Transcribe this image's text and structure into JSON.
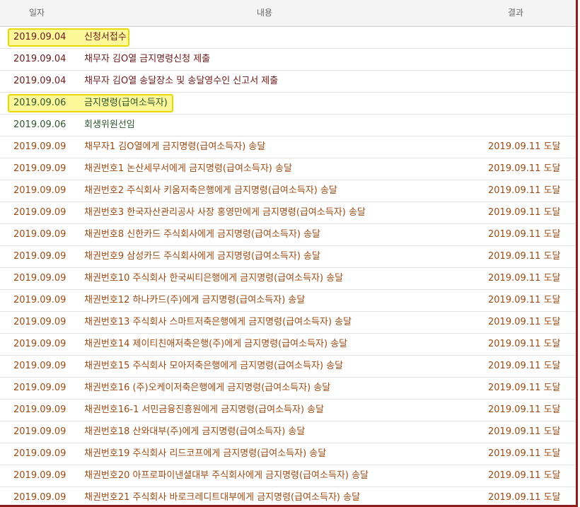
{
  "table": {
    "headers": {
      "date": "일자",
      "content": "내용",
      "result": "결과"
    },
    "rows": [
      {
        "date": "2019.09.04",
        "content": "신청서접수",
        "result": "",
        "kind": "filing",
        "highlight": true
      },
      {
        "date": "2019.09.04",
        "content": "채무자 김O열 금지명령신청 제출",
        "result": "",
        "kind": "filing",
        "highlight": false
      },
      {
        "date": "2019.09.04",
        "content": "채무자 김O열 송달장소 및 송달영수인 신고서 제출",
        "result": "",
        "kind": "filing",
        "highlight": false
      },
      {
        "date": "2019.09.06",
        "content": "금지명령(급여소득자)",
        "result": "",
        "kind": "court",
        "highlight": true
      },
      {
        "date": "2019.09.06",
        "content": "회생위원선임",
        "result": "",
        "kind": "court",
        "highlight": false
      },
      {
        "date": "2019.09.09",
        "content": "채무자1 김O열에게 금지명령(급여소득자) 송달",
        "result": "2019.09.11 도달",
        "kind": "delivery",
        "highlight": false
      },
      {
        "date": "2019.09.09",
        "content": "채권번호1 논산세무서에게 금지명령(급여소득자) 송달",
        "result": "2019.09.11 도달",
        "kind": "delivery",
        "highlight": false
      },
      {
        "date": "2019.09.09",
        "content": "채권번호2 주식회사 키움저축은행에게 금지명령(급여소득자) 송달",
        "result": "2019.09.11 도달",
        "kind": "delivery",
        "highlight": false
      },
      {
        "date": "2019.09.09",
        "content": "채권번호3 한국자산관리공사 사장 홍영만에게 금지명령(급여소득자) 송달",
        "result": "2019.09.11 도달",
        "kind": "delivery",
        "highlight": false
      },
      {
        "date": "2019.09.09",
        "content": "채권번호8 신한카드 주식회사에게 금지명령(급여소득자) 송달",
        "result": "2019.09.11 도달",
        "kind": "delivery",
        "highlight": false
      },
      {
        "date": "2019.09.09",
        "content": "채권번호9 삼성카드 주식회사에게 금지명령(급여소득자) 송달",
        "result": "2019.09.11 도달",
        "kind": "delivery",
        "highlight": false
      },
      {
        "date": "2019.09.09",
        "content": "채권번호10 주식회사 한국씨티은행에게 금지명령(급여소득자) 송달",
        "result": "2019.09.11 도달",
        "kind": "delivery",
        "highlight": false
      },
      {
        "date": "2019.09.09",
        "content": "채권번호12 하나카드(주)에게 금지명령(급여소득자) 송달",
        "result": "2019.09.11 도달",
        "kind": "delivery",
        "highlight": false
      },
      {
        "date": "2019.09.09",
        "content": "채권번호13 주식회사 스마트저축은행에게 금지명령(급여소득자) 송달",
        "result": "2019.09.11 도달",
        "kind": "delivery",
        "highlight": false
      },
      {
        "date": "2019.09.09",
        "content": "채권번호14 제이티친애저축은행(주)에게 금지명령(급여소득자) 송달",
        "result": "2019.09.11 도달",
        "kind": "delivery",
        "highlight": false
      },
      {
        "date": "2019.09.09",
        "content": "채권번호15 주식회사 모아저축은행에게 금지명령(급여소득자) 송달",
        "result": "2019.09.11 도달",
        "kind": "delivery",
        "highlight": false
      },
      {
        "date": "2019.09.09",
        "content": "채권번호16 (주)오케이저축은행에게 금지명령(급여소득자) 송달",
        "result": "2019.09.11 도달",
        "kind": "delivery",
        "highlight": false
      },
      {
        "date": "2019.09.09",
        "content": "채권번호16-1 서민금융진흥원에게 금지명령(급여소득자) 송달",
        "result": "2019.09.11 도달",
        "kind": "delivery",
        "highlight": false
      },
      {
        "date": "2019.09.09",
        "content": "채권번호18 산와대부(주)에게 금지명령(급여소득자) 송달",
        "result": "2019.09.11 도달",
        "kind": "delivery",
        "highlight": false
      },
      {
        "date": "2019.09.09",
        "content": "채권번호19 주식회사 리드코프에게 금지명령(급여소득자) 송달",
        "result": "2019.09.11 도달",
        "kind": "delivery",
        "highlight": false
      },
      {
        "date": "2019.09.09",
        "content": "채권번호20 아프로파이낸셜대부 주식회사에게 금지명령(급여소득자) 송달",
        "result": "2019.09.11 도달",
        "kind": "delivery",
        "highlight": false
      },
      {
        "date": "2019.09.09",
        "content": "채권번호21 주식회사 바로크레디트대부에게 금지명령(급여소득자) 송달",
        "result": "2019.09.11 도달",
        "kind": "delivery",
        "highlight": false
      }
    ]
  },
  "colors": {
    "filing_text": "#6b1a1a",
    "court_text": "#2e5530",
    "delivery_text": "#9a4b14",
    "highlight_fill": "#fcf89a",
    "highlight_border": "#e8d800",
    "frame_border": "#8e1d1d"
  }
}
